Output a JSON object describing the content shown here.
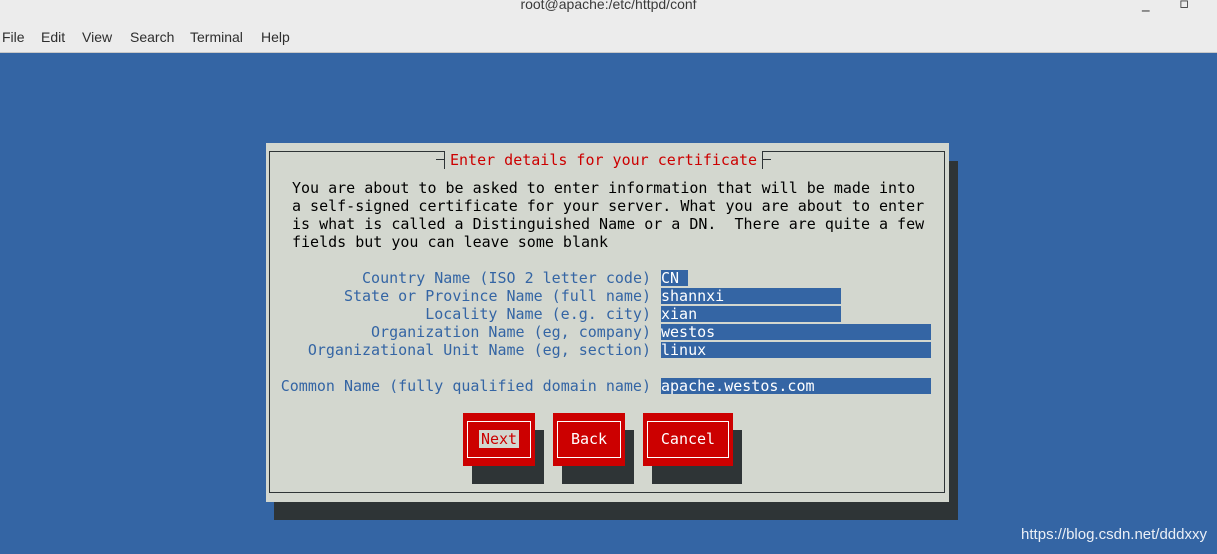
{
  "window": {
    "title": "root@apache:/etc/httpd/conf",
    "minimize_glyph": "_",
    "maximize_glyph": "▫"
  },
  "menu": [
    "File",
    "Edit",
    "View",
    "Search",
    "Terminal",
    "Help"
  ],
  "dialog": {
    "title": "Enter details for your certificate",
    "intro": [
      "You are about to be asked to enter information that will be made into",
      "a self-signed certificate for your server. What you are about to enter",
      "is what is called a Distinguished Name or a DN.  There are quite a few",
      "fields but you can leave some blank"
    ],
    "fields": [
      {
        "label": "Country Name (ISO 2 letter code)",
        "value": "CN"
      },
      {
        "label": "State or Province Name (full name)",
        "value": "shannxi"
      },
      {
        "label": "Locality Name (e.g. city)",
        "value": "xian"
      },
      {
        "label": "Organization Name (eg, company)",
        "value": "westos"
      },
      {
        "label": "Organizational Unit Name (eg, section)",
        "value": "linux"
      },
      {
        "label": "Common Name (fully qualified domain name)",
        "value": "apache.westos.com"
      }
    ],
    "buttons": {
      "next": "Next",
      "back": "Back",
      "cancel": "Cancel"
    }
  },
  "watermark": "https://blog.csdn.net/dddxxy",
  "colors": {
    "background": "#3465a4",
    "dialog": "#d3d7cf",
    "accent": "#cc0000",
    "field": "#3465a4"
  }
}
